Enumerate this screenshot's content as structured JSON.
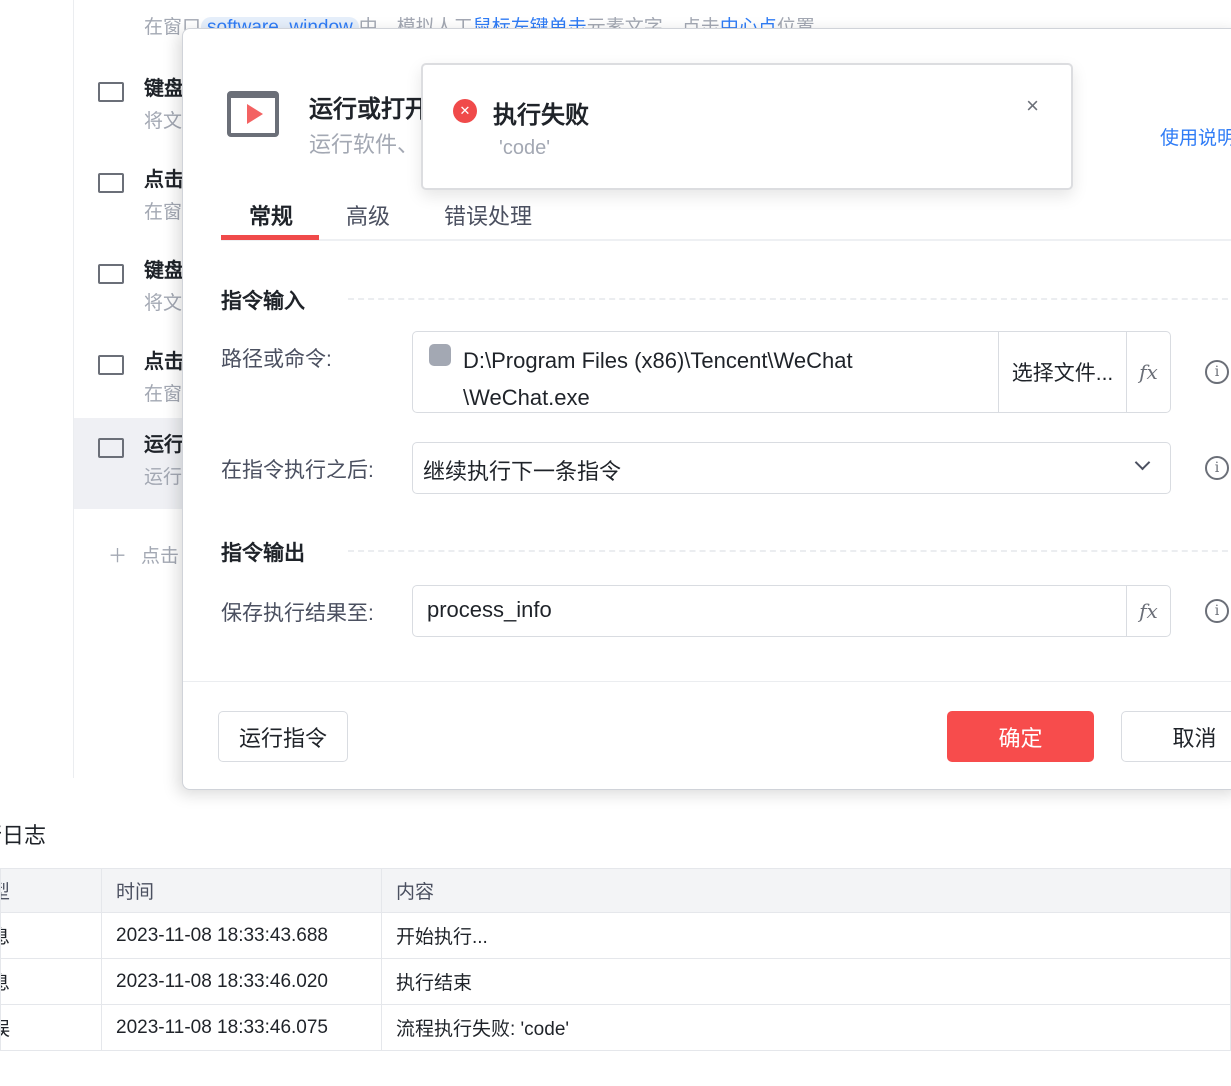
{
  "background_list": {
    "top_desc": {
      "pre": "在窗口",
      "var": "software_window",
      "mid": "中，模拟人工",
      "link1": "鼠标左键单击",
      "mid2": "元素文字，点击",
      "link2": "中心点",
      "post": "位置"
    },
    "items": [
      {
        "title": "键盘",
        "desc": "将文"
      },
      {
        "title": "点击",
        "desc": "在窗"
      },
      {
        "title": "键盘",
        "desc": "将文"
      },
      {
        "title": "点击",
        "desc": "在窗"
      },
      {
        "title": "运行",
        "desc": "运行"
      }
    ],
    "add_label": "点击"
  },
  "log": {
    "title": "行日志",
    "columns": [
      "型",
      "时间",
      "内容"
    ],
    "rows": [
      [
        "息",
        "2023-11-08 18:33:43.688",
        "开始执行..."
      ],
      [
        "息",
        "2023-11-08 18:33:46.020",
        "执行结束"
      ],
      [
        "误",
        "2023-11-08 18:33:46.075",
        "流程执行失败: 'code'"
      ]
    ]
  },
  "dialog": {
    "title": "运行或打开",
    "subtitle": "运行软件、",
    "help": "使用说明",
    "tabs": [
      "常规",
      "高级",
      "错误处理"
    ],
    "section_input": "指令输入",
    "path_label": "路径或命令:",
    "path_value_line1": "D:\\Program Files (x86)\\Tencent\\WeChat",
    "path_value_line2": "\\WeChat.exe",
    "choose_file": "选择文件...",
    "fx": "fx",
    "after_label": "在指令执行之后:",
    "after_value": "继续执行下一条指令",
    "section_output": "指令输出",
    "save_label": "保存执行结果至:",
    "save_value": "process_info",
    "run_button": "运行指令",
    "ok_button": "确定",
    "cancel_button": "取消"
  },
  "toast": {
    "title": "执行失败",
    "message": "'code'",
    "close": "×"
  },
  "colors": {
    "accent": "#f04a4a",
    "link": "#2f7cf6"
  }
}
